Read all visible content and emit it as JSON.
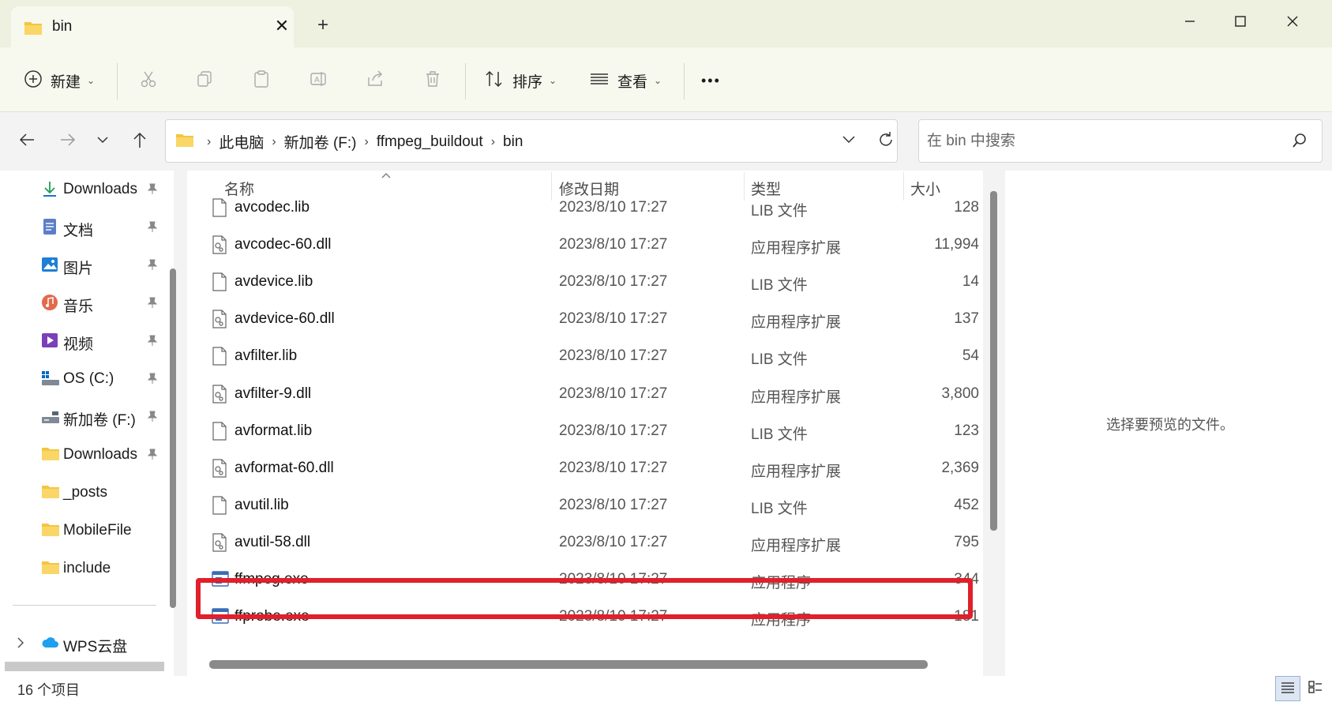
{
  "window": {
    "tab_title": "bin",
    "new_tab": "+",
    "min": "—",
    "max": "☐",
    "close": "✕"
  },
  "toolbar": {
    "new_label": "新建",
    "sort_label": "排序",
    "view_label": "查看",
    "more_label": "•••"
  },
  "address": {
    "crumbs": [
      "此电脑",
      "新加卷 (F:)",
      "ffmpeg_buildout",
      "bin"
    ]
  },
  "search": {
    "placeholder": "在 bin 中搜索"
  },
  "sidebar": {
    "items": [
      {
        "label": "Downloads",
        "icon": "download-icon",
        "pinned": true
      },
      {
        "label": "文档",
        "icon": "document-icon",
        "pinned": true
      },
      {
        "label": "图片",
        "icon": "picture-icon",
        "pinned": true
      },
      {
        "label": "音乐",
        "icon": "music-icon",
        "pinned": true
      },
      {
        "label": "视频",
        "icon": "video-icon",
        "pinned": true
      },
      {
        "label": "OS (C:)",
        "icon": "drive-icon",
        "pinned": true
      },
      {
        "label": "新加卷 (F:)",
        "icon": "drive-icon",
        "pinned": true
      },
      {
        "label": "Downloads",
        "icon": "folder-icon",
        "pinned": true
      },
      {
        "label": "_posts",
        "icon": "folder-icon",
        "pinned": false
      },
      {
        "label": "MobileFile",
        "icon": "folder-icon",
        "pinned": false
      },
      {
        "label": "include",
        "icon": "folder-icon",
        "pinned": false
      }
    ],
    "wps_label": "WPS云盘"
  },
  "columns": {
    "name": "名称",
    "date": "修改日期",
    "type": "类型",
    "size": "大小"
  },
  "files": [
    {
      "name": "avcodec.lib",
      "date": "2023/8/10 17:27",
      "type": "LIB 文件",
      "size": "128",
      "icon": "lib"
    },
    {
      "name": "avcodec-60.dll",
      "date": "2023/8/10 17:27",
      "type": "应用程序扩展",
      "size": "11,994",
      "icon": "dll"
    },
    {
      "name": "avdevice.lib",
      "date": "2023/8/10 17:27",
      "type": "LIB 文件",
      "size": "14",
      "icon": "lib"
    },
    {
      "name": "avdevice-60.dll",
      "date": "2023/8/10 17:27",
      "type": "应用程序扩展",
      "size": "137",
      "icon": "dll"
    },
    {
      "name": "avfilter.lib",
      "date": "2023/8/10 17:27",
      "type": "LIB 文件",
      "size": "54",
      "icon": "lib"
    },
    {
      "name": "avfilter-9.dll",
      "date": "2023/8/10 17:27",
      "type": "应用程序扩展",
      "size": "3,800",
      "icon": "dll"
    },
    {
      "name": "avformat.lib",
      "date": "2023/8/10 17:27",
      "type": "LIB 文件",
      "size": "123",
      "icon": "lib"
    },
    {
      "name": "avformat-60.dll",
      "date": "2023/8/10 17:27",
      "type": "应用程序扩展",
      "size": "2,369",
      "icon": "dll"
    },
    {
      "name": "avutil.lib",
      "date": "2023/8/10 17:27",
      "type": "LIB 文件",
      "size": "452",
      "icon": "lib"
    },
    {
      "name": "avutil-58.dll",
      "date": "2023/8/10 17:27",
      "type": "应用程序扩展",
      "size": "795",
      "icon": "dll"
    },
    {
      "name": "ffmpeg.exe",
      "date": "2023/8/10 17:27",
      "type": "应用程序",
      "size": "344",
      "icon": "exe"
    },
    {
      "name": "ffprobe.exe",
      "date": "2023/8/10 17:27",
      "type": "应用程序",
      "size": "181",
      "icon": "exe"
    }
  ],
  "preview": {
    "message": "选择要预览的文件。"
  },
  "status": {
    "count": "16 个项目"
  },
  "colors": {
    "highlight": "#e0202a",
    "folder": "#f4c542",
    "accent": "#0067c0"
  }
}
